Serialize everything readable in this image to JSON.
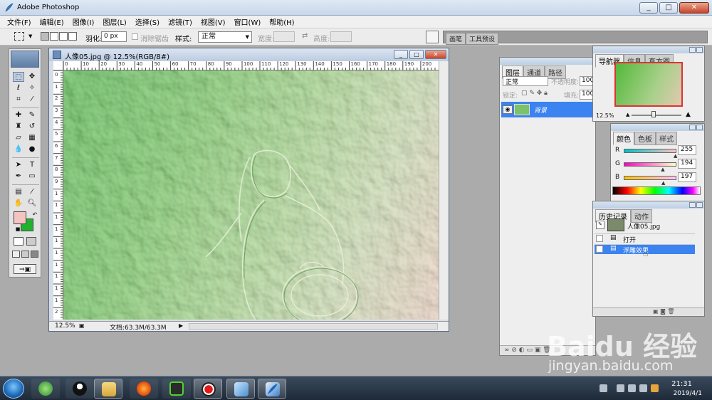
{
  "app": {
    "title": "Adobe Photoshop",
    "window_buttons": [
      "_",
      "□",
      "✕"
    ]
  },
  "menu": [
    "文件(F)",
    "编辑(E)",
    "图像(I)",
    "图层(L)",
    "选择(S)",
    "滤镜(T)",
    "视图(V)",
    "窗口(W)",
    "帮助(H)"
  ],
  "options": {
    "feather_label": "羽化:",
    "feather_value": "0 px",
    "antialias_label": "消除锯齿",
    "style_label": "样式:",
    "style_value": "正常",
    "width_label": "宽度:",
    "height_label": "高度:",
    "palette_tabs": [
      "画笔",
      "工具预设"
    ]
  },
  "document": {
    "title": "人像05.jpg @ 12.5%(RGB/8#)",
    "zoom": "12.5%",
    "doc_info": "文档:63.3M/63.3M",
    "ruler_h": [
      "0",
      "10",
      "20",
      "30",
      "40",
      "50",
      "60",
      "70",
      "80",
      "90",
      "100",
      "110",
      "120",
      "130",
      "140",
      "150",
      "160",
      "170",
      "180",
      "190",
      "200"
    ],
    "ruler_v": [
      "0",
      "1",
      "2",
      "3",
      "4",
      "5",
      "6",
      "7",
      "8",
      "9",
      "1",
      "1",
      "1",
      "1",
      "1",
      "1",
      "1",
      "1",
      "1",
      "1",
      "2"
    ]
  },
  "layers_panel": {
    "tabs": [
      "图层",
      "通道",
      "路径"
    ],
    "blend_mode": "正常",
    "opacity_label": "不透明度:",
    "opacity_value": "100",
    "lock_label": "锁定:",
    "fill_label": "填充:",
    "fill_value": "100",
    "layer_name": "背景"
  },
  "navigator_panel": {
    "tabs": [
      "导航器",
      "信息",
      "直方图"
    ],
    "zoom": "12.5%"
  },
  "color_panel": {
    "tabs": [
      "颜色",
      "色板",
      "样式"
    ],
    "channels": [
      {
        "label": "R",
        "value": "255"
      },
      {
        "label": "G",
        "value": "194"
      },
      {
        "label": "B",
        "value": "197"
      }
    ],
    "channel_levels": [
      1.0,
      0.76,
      0.77
    ]
  },
  "history_panel": {
    "tabs": [
      "历史记录",
      "动作"
    ],
    "snapshot": "人像05.jpg",
    "items": [
      "打开",
      "浮雕效果"
    ],
    "active_item": "浮雕效果"
  },
  "colors": {
    "foreground": "#f5c3c0",
    "background": "#22b22f",
    "selection": "#3a83f0"
  },
  "taskbar": {
    "apps": [
      "ie-icon",
      "qq-icon",
      "explorer-icon",
      "firefox-icon",
      "iqiyi-icon",
      "recorder-icon",
      "app-icon",
      "photoshop-icon"
    ],
    "time": "21:31",
    "date": "2019/4/1"
  },
  "watermark": {
    "logo": "Baidu 经验",
    "url": "jingyan.baidu.com"
  }
}
